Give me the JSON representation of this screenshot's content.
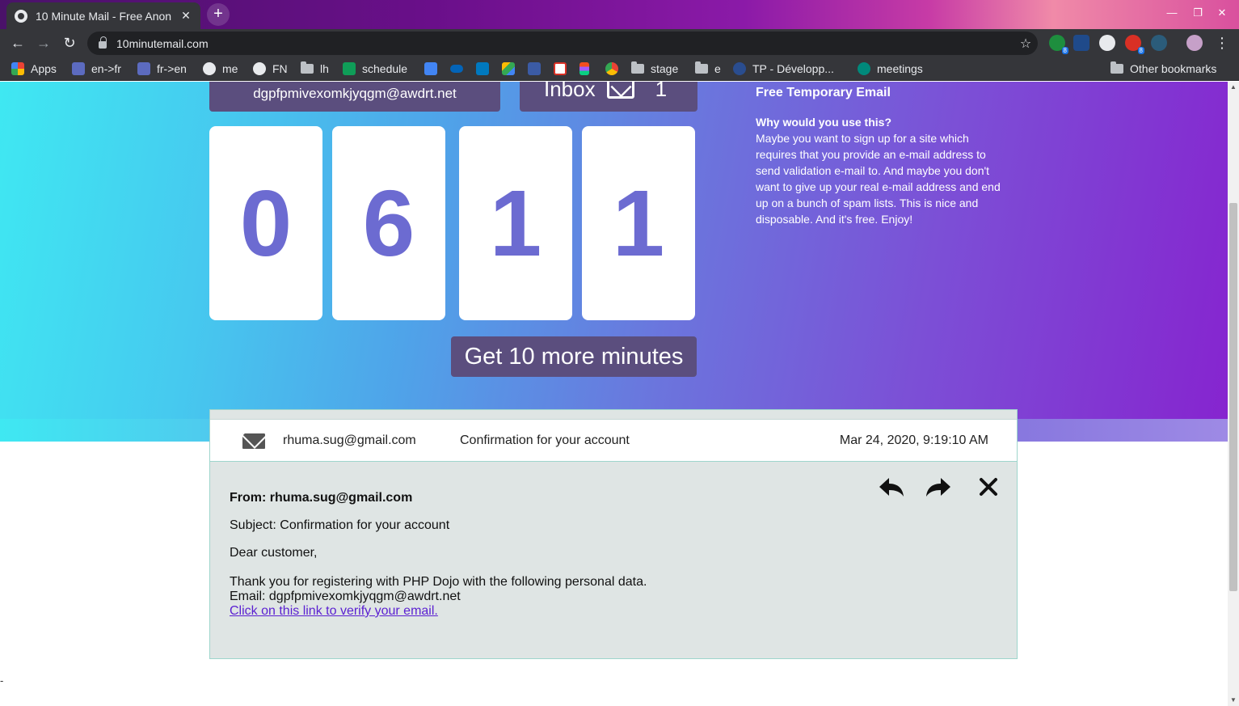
{
  "browser": {
    "tab_title": "10 Minute Mail - Free Anon",
    "url": "10minutemail.com",
    "bookmarks": [
      {
        "label": "Apps",
        "kind": "apps"
      },
      {
        "label": "en->fr",
        "kind": "translate"
      },
      {
        "label": "fr->en",
        "kind": "translate"
      },
      {
        "label": "me",
        "kind": "github"
      },
      {
        "label": "FN",
        "kind": "github"
      },
      {
        "label": "lh",
        "kind": "folder"
      },
      {
        "label": "schedule",
        "kind": "sheets"
      },
      {
        "label": "",
        "kind": "docs"
      },
      {
        "label": "",
        "kind": "onedrive"
      },
      {
        "label": "",
        "kind": "trello"
      },
      {
        "label": "",
        "kind": "drive"
      },
      {
        "label": "",
        "kind": "ee"
      },
      {
        "label": "",
        "kind": "gmail"
      },
      {
        "label": "",
        "kind": "figma"
      },
      {
        "label": "",
        "kind": "chrome"
      },
      {
        "label": "stage",
        "kind": "folder"
      },
      {
        "label": "e",
        "kind": "folder"
      },
      {
        "label": "TP - Développ...",
        "kind": "site"
      },
      {
        "label": "meetings",
        "kind": "meet"
      }
    ],
    "other_bookmarks": "Other bookmarks",
    "ext_badges": [
      "8",
      "8"
    ]
  },
  "hero": {
    "email_address": "dgpfpmivexomkjyqgm@awdrt.net",
    "inbox_label": "Inbox",
    "inbox_count": "1",
    "timer_digits": [
      "0",
      "6",
      "1",
      "1"
    ],
    "more_minutes_button": "Get 10 more minutes"
  },
  "side_info": {
    "heading": "Free Temporary Email",
    "question": "Why would you use this?",
    "body": "Maybe you want to sign up for a site which requires that you provide an e-mail address to send validation e-mail to. And maybe you don't want to give up your real e-mail address and end up on a bunch of spam lists. This is nice and disposable. And it's free. Enjoy!"
  },
  "mail": {
    "row": {
      "sender": "rhuma.sug@gmail.com",
      "subject": "Confirmation for your account",
      "date": "Mar 24, 2020, 9:19:10 AM"
    },
    "message": {
      "from_line": "From: rhuma.sug@gmail.com",
      "subject_line": "Subject: Confirmation for your account",
      "greeting": "Dear customer,",
      "body_line1": "Thank you for registering with PHP Dojo with the following personal data.",
      "body_line2": "Email: dgpfpmivexomkjyqgm@awdrt.net",
      "verify_link": "Click on this link to verify your email."
    }
  },
  "footer_dash": "-"
}
